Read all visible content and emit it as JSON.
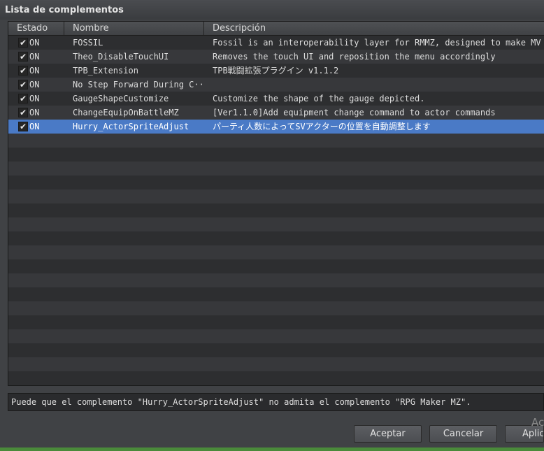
{
  "window": {
    "title": "Lista de complementos"
  },
  "columns": {
    "status": "Estado",
    "name": "Nombre",
    "description": "Descripción"
  },
  "plugins": [
    {
      "status": "ON",
      "name": "FOSSIL",
      "description": "Fossil is an interoperability layer for RMMZ, designed to make MV p·",
      "checked": true
    },
    {
      "status": "ON",
      "name": "Theo_DisableTouchUI",
      "description": "Removes the touch UI and reposition the menu accordingly",
      "checked": true
    },
    {
      "status": "ON",
      "name": "TPB_Extension",
      "description": "TPB戦闘拡張プラグイン v1.1.2",
      "checked": true
    },
    {
      "status": "ON",
      "name": "No Step Forward During C···",
      "description": "",
      "checked": true
    },
    {
      "status": "ON",
      "name": "GaugeShapeCustomize",
      "description": "Customize the shape of the gauge depicted.",
      "checked": true
    },
    {
      "status": "ON",
      "name": "ChangeEquipOnBattleMZ",
      "description": "[Ver1.1.0]Add equipment change command to actor commands",
      "checked": true
    },
    {
      "status": "ON",
      "name": "Hurry_ActorSpriteAdjust",
      "description": "パーティ人数によってSVアクターの位置を自動調整します",
      "checked": true,
      "selected": true
    }
  ],
  "status_message": "Puede que el complemento \"Hurry_ActorSpriteAdjust\" no admita el complemento \"RPG Maker MZ\".",
  "buttons": {
    "ok": "Aceptar",
    "cancel": "Cancelar",
    "apply": "Aplic"
  },
  "watermark": "Ac"
}
